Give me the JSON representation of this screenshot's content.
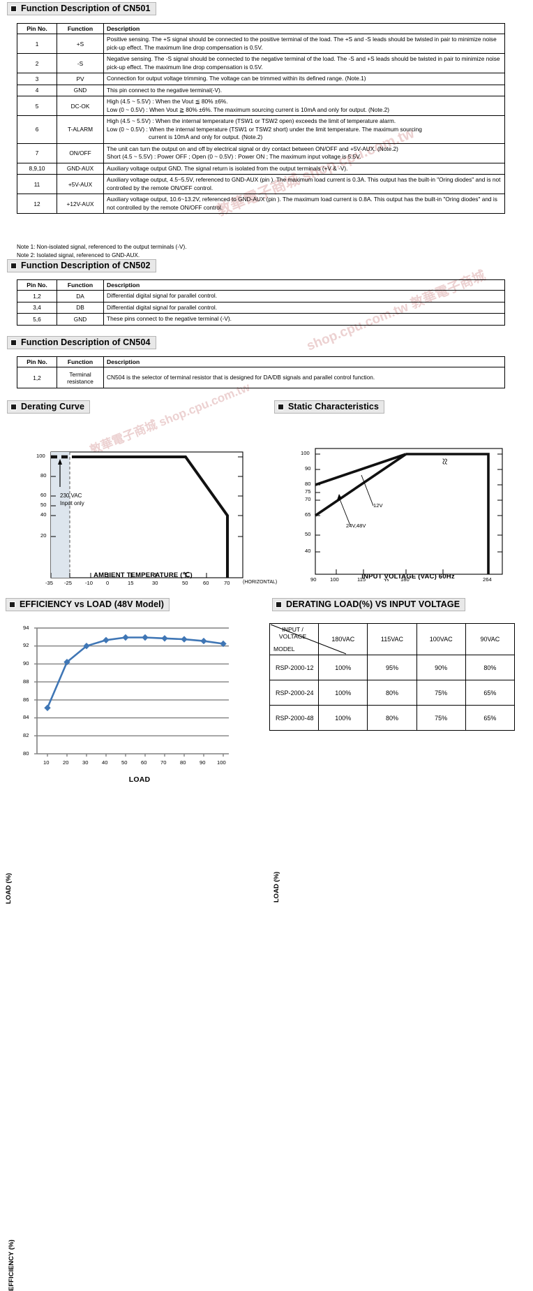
{
  "sections": {
    "cn501": "Function Description of CN501",
    "cn502": "Function Description of CN502",
    "cn504": "Function Description of CN504",
    "derating_curve": "Derating Curve",
    "static_characteristics": "Static Characteristics",
    "efficiency": "EFFICIENCY vs LOAD (48V Model)",
    "derating_load": "DERATING LOAD(%) VS INPUT VOLTAGE"
  },
  "table_headers": {
    "pin": "Pin No.",
    "function": "Function",
    "description": "Description"
  },
  "cn501_rows": [
    {
      "pin": "1",
      "fn": "+S",
      "desc": "Positive sensing. The +S signal should be connected to the positive terminal of the load. The +S and -S leads should be twisted in pair to minimize noise pick-up effect. The maximum line drop compensation is 0.5V."
    },
    {
      "pin": "2",
      "fn": "-S",
      "desc": "Negative sensing. The -S signal should be connected to the negative terminal of the load. The -S and +S leads should be twisted in pair to minimize noise pick-up effect. The maximum line drop compensation is 0.5V."
    },
    {
      "pin": "3",
      "fn": "PV",
      "desc": "Connection for output voltage trimming. The voltage can be trimmed within its defined range. (Note.1)"
    },
    {
      "pin": "4",
      "fn": "GND",
      "desc": "This pin connect to the negative terminal(-V)."
    },
    {
      "pin": "5",
      "fn": "DC-OK",
      "desc_l1": "High (4.5 ~ 5.5V) : When the Vout ≦ 80% ±6%.",
      "desc_l2": "Low (0 ~ 0.5V) : When Vout ≧ 80% ±6%. The maximum sourcing current is 10mA and only for output. (Note.2)"
    },
    {
      "pin": "6",
      "fn": "T-ALARM",
      "desc_l1": "High (4.5 ~ 5.5V) : When the internal temperature (TSW1 or TSW2 open) exceeds the limit of temperature alarm.",
      "desc_l2": "Low (0 ~ 0.5V) : When the internal temperature (TSW1 or TSW2 short) under the limit temperature. The maximum sourcing",
      "desc_l3": "current is 10mA and only for output. (Note.2)"
    },
    {
      "pin": "7",
      "fn": "ON/OFF",
      "desc_l1": "The unit can turn the output on and off by electrical signal or dry contact between ON/OFF and +5V-AUX. (Note.2)",
      "desc_l2": "Short (4.5 ~ 5.5V) : Power OFF ; Open (0 ~ 0.5V) : Power ON ; The maximum input voltage is 5.5V."
    },
    {
      "pin": "8,9,10",
      "fn": "GND-AUX",
      "desc": "Auxiliary voltage output GND. The signal return is isolated from the output terminals (+V & -V)."
    },
    {
      "pin": "11",
      "fn": "+5V-AUX",
      "desc": "Auxiliary voltage output, 4.5~5.5V, referenced to GND-AUX (pin  ). The maximum load current is 0.3A. This output has the built-in \"Oring diodes\" and is not controlled by the remote ON/OFF control."
    },
    {
      "pin": "12",
      "fn": "+12V-AUX",
      "desc": "Auxiliary voltage output, 10.6~13.2V, referenced to GND-AUX (pin  ). The maximum load current is 0.8A. This output has the built-in \"Oring diodes\" and is not controlled by the remote ON/OFF control."
    }
  ],
  "notes": [
    "Note 1: Non-isolated signal, referenced to the output terminals (-V).",
    "Note 2: Isolated signal, referenced to GND-AUX."
  ],
  "cn502_rows": [
    {
      "pin": "1,2",
      "fn": "DA",
      "desc": "Differential digital signal for parallel control."
    },
    {
      "pin": "3,4",
      "fn": "DB",
      "desc": "Differential digital signal for parallel control."
    },
    {
      "pin": "5,6",
      "fn": "GND",
      "desc": "These pins connect to the negative terminal (-V)."
    }
  ],
  "cn504_rows": [
    {
      "pin": "1,2",
      "fn_l1": "Terminal",
      "fn_l2": "resistance",
      "desc": "CN504 is the selector of terminal resistor that is designed for DA/DB signals and parallel control function."
    }
  ],
  "chart_data": [
    {
      "type": "line",
      "name": "derating-curve",
      "title": "Derating Curve",
      "xlabel": "AMBIENT TEMPERATURE (℃)",
      "ylabel": "LOAD (%)",
      "xticks": [
        "-35",
        "-25",
        "-10",
        "0",
        "15",
        "30",
        "50",
        "60",
        "70"
      ],
      "yticks": [
        "100",
        "80",
        "60",
        "50",
        "40",
        "20"
      ],
      "xlim": [
        -35,
        75
      ],
      "ylim": [
        0,
        110
      ],
      "x": [
        -35,
        50,
        70,
        70
      ],
      "values": [
        100,
        100,
        50,
        0
      ],
      "dashed_segment": {
        "x": [
          -35,
          -25
        ],
        "y": [
          100,
          100
        ]
      },
      "shaded_region": {
        "x_from": -35,
        "x_to": -25,
        "label_line1": "230 VAC",
        "label_line2": "Input only"
      },
      "x_axis_suffix": "(HORIZONTAL)",
      "grid": false,
      "legend": "none"
    },
    {
      "type": "line",
      "name": "static-characteristics",
      "title": "Static Characteristics",
      "xlabel": "INPUT VOLTAGE (VAC) 60Hz",
      "ylabel": "LOAD (%)",
      "xticks": [
        "90",
        "100",
        "115",
        "180",
        "264"
      ],
      "yticks": [
        "100",
        "90",
        "80",
        "75",
        "70",
        "65",
        "50",
        "40"
      ],
      "series": [
        {
          "name": "12V",
          "x": [
            90,
            180,
            264,
            264
          ],
          "values": [
            80,
            100,
            100,
            0
          ]
        },
        {
          "name": "24V,48V",
          "x": [
            90,
            180
          ],
          "values": [
            65,
            100
          ]
        }
      ],
      "annotations": [
        "12V",
        "24V,48V"
      ],
      "axis_breaks": [
        "x-axis between 115 and 180",
        "y-top between 180 and 264"
      ],
      "grid": false,
      "legend": "inline-annotation"
    },
    {
      "type": "line",
      "name": "efficiency-vs-load",
      "title": "EFFICIENCY vs LOAD (48V Model)",
      "xlabel": "LOAD",
      "ylabel": "EFFICIENCY (%)",
      "categories": [
        10,
        20,
        30,
        40,
        50,
        60,
        70,
        80,
        90,
        100
      ],
      "values": [
        85.1,
        90.2,
        92.0,
        92.65,
        92.95,
        92.95,
        92.85,
        92.75,
        92.55,
        92.25
      ],
      "xticks": [
        "10",
        "20",
        "30",
        "40",
        "50",
        "60",
        "70",
        "80",
        "90",
        "100"
      ],
      "yticks": [
        "80",
        "82",
        "84",
        "86",
        "88",
        "90",
        "92",
        "94"
      ],
      "ylim": [
        80,
        94
      ],
      "series_color": "#3f76b5",
      "marker": "diamond",
      "grid": true,
      "legend": "none"
    },
    {
      "type": "table",
      "name": "derating-load-vs-input-voltage",
      "title": "DERATING LOAD(%) VS INPUT VOLTAGE",
      "corner_row_label": "INPUT / VOLTAGE",
      "corner_col_label": "MODEL",
      "columns": [
        "180VAC",
        "115VAC",
        "100VAC",
        "90VAC"
      ],
      "rows": [
        {
          "model": "RSP-2000-12",
          "values": [
            "100%",
            "95%",
            "90%",
            "80%"
          ]
        },
        {
          "model": "RSP-2000-24",
          "values": [
            "100%",
            "80%",
            "75%",
            "65%"
          ]
        },
        {
          "model": "RSP-2000-48",
          "values": [
            "100%",
            "80%",
            "75%",
            "65%"
          ]
        }
      ]
    }
  ],
  "watermarks": [
    "敦華電子商城 shop.cpu.com.tw",
    "shop.cpu.com.tw 敦華電子商城"
  ]
}
